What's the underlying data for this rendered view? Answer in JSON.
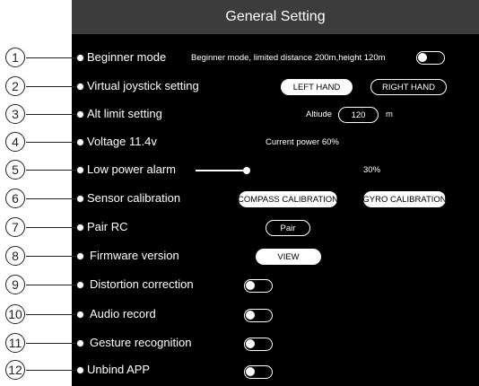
{
  "header": {
    "title": "General Setting"
  },
  "rows": [
    {
      "num": "1",
      "label": "Beginner mode",
      "desc": "Beginner mode, limited distance 200m,height 120m"
    },
    {
      "num": "2",
      "label": "Virtual joystick setting",
      "left_hand": "LEFT HAND",
      "right_hand": "RIGHT HAND"
    },
    {
      "num": "3",
      "label": "Alt limit setting",
      "alt_label": "Altiude",
      "alt_value": "120",
      "alt_unit": "m"
    },
    {
      "num": "4",
      "label": "Voltage 11.4v",
      "power": "Current power 60%"
    },
    {
      "num": "5",
      "label": "Low power alarm",
      "percent": "30%",
      "level": 0.3
    },
    {
      "num": "6",
      "label": "Sensor calibration",
      "compass": "COMPASS CALIBRATION",
      "gyro": "GYRO CALIBRATION"
    },
    {
      "num": "7",
      "label": "Pair RC",
      "pair": "Pair"
    },
    {
      "num": "8",
      "label": "Firmware version",
      "view": "VIEW"
    },
    {
      "num": "9",
      "label": "Distortion correction"
    },
    {
      "num": "10",
      "label": "Audio record"
    },
    {
      "num": "11",
      "label": "Gesture recognition"
    },
    {
      "num": "12",
      "label": "Unbind APP"
    }
  ],
  "colors": {
    "header_bg": "#3c3c3c",
    "panel_bg": "#000000",
    "foreground": "#ffffff"
  }
}
